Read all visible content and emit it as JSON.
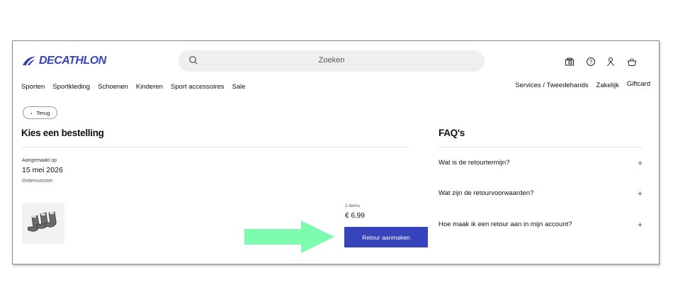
{
  "header": {
    "logo_text": "DECATHLON",
    "search_placeholder": "Zoeken",
    "icons": [
      "store-icon",
      "help-icon",
      "account-icon",
      "cart-icon"
    ]
  },
  "nav": {
    "left": [
      "Sporten",
      "Sportkleding",
      "Schoenen",
      "Kinderen",
      "Sport accessoires",
      "Sale"
    ],
    "right": [
      "Services / Tweedehands",
      "Zakelijk",
      "Giftcard"
    ]
  },
  "back_label": "Terug",
  "page_title": "Kies een bestelling",
  "order": {
    "created_label": "Aangemaakt op",
    "created_date": "15 mei 2026",
    "order_number_label": "Ordernummer",
    "item_count": "2 items",
    "price": "€ 6,99",
    "return_button": "Retour aanmaken"
  },
  "faq": {
    "title": "FAQ's",
    "items": [
      {
        "question": "Wat is de retourtermijn?"
      },
      {
        "question": "Wat zijn de retourvoorwaarden?"
      },
      {
        "question": "Hoe maak ik een retour aan in mijn account?"
      }
    ],
    "expand_symbol": "+"
  },
  "colors": {
    "brand": "#3643ba",
    "arrow": "#7dfbae"
  }
}
